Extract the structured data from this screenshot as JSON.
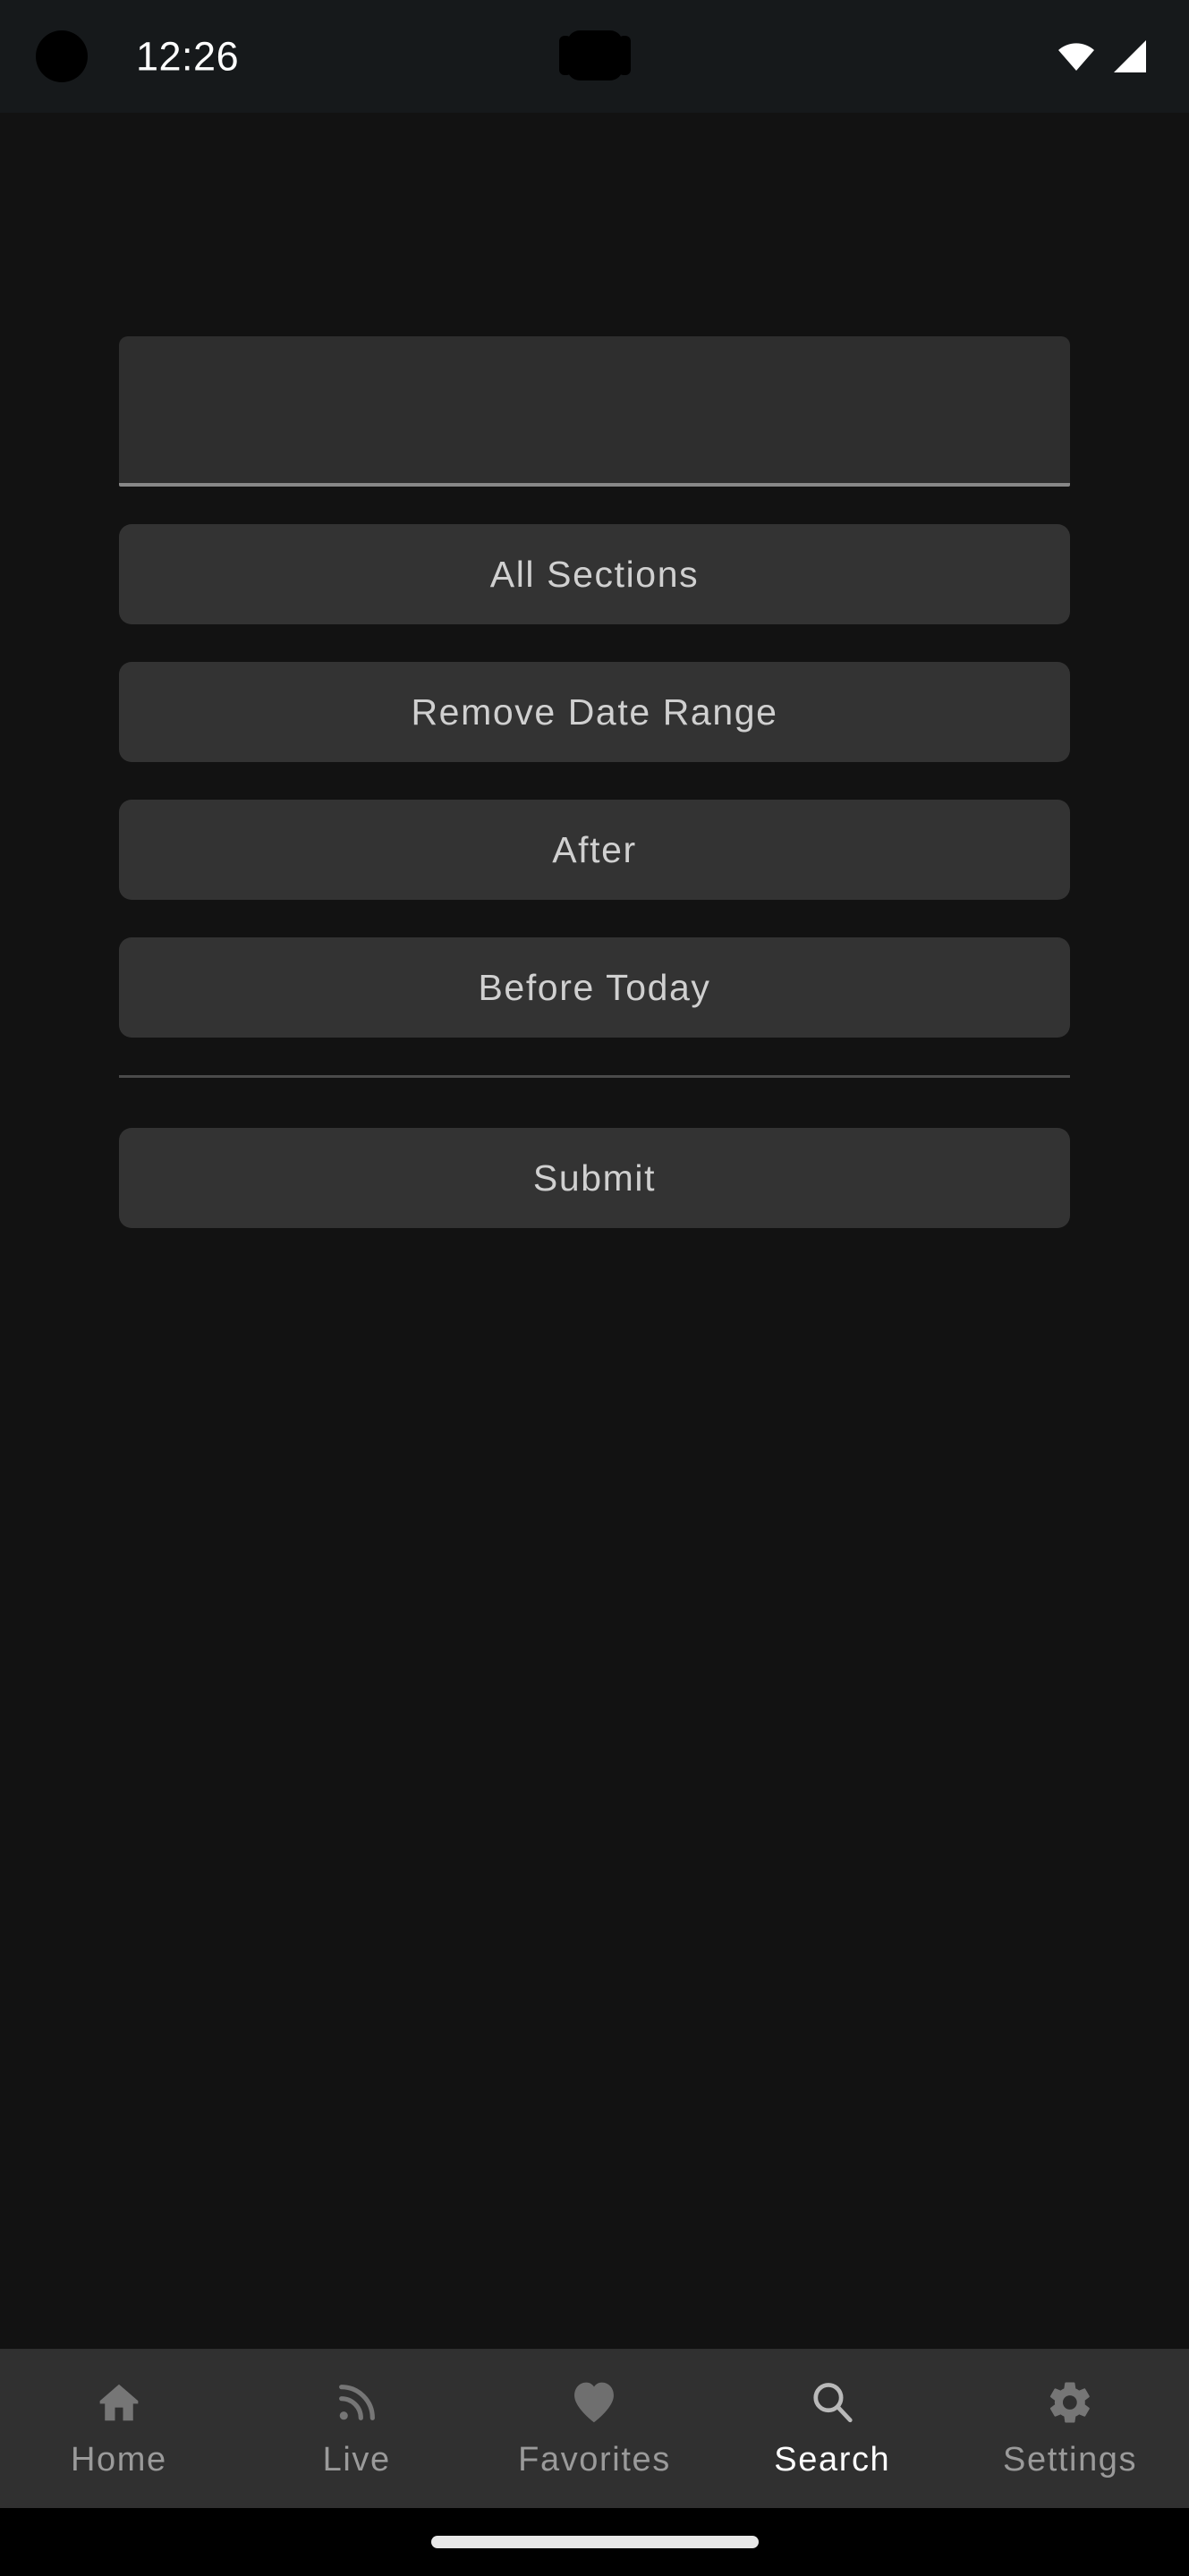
{
  "status_bar": {
    "time": "12:26",
    "icons": [
      {
        "name": "wifi-icon",
        "label": "wifi"
      },
      {
        "name": "cellular-signal-icon",
        "label": "signal"
      }
    ]
  },
  "screen": {
    "background_color": "#121212",
    "surface_color": "#333333",
    "accent_text_color": "#ffffff",
    "muted_text_color": "#9a9a9a"
  },
  "search_form": {
    "query_input": {
      "value": "",
      "placeholder": ""
    },
    "buttons": [
      {
        "id": "all-sections",
        "label": "All Sections"
      },
      {
        "id": "remove-date-range",
        "label": "Remove Date Range"
      },
      {
        "id": "after",
        "label": "After"
      },
      {
        "id": "before-today",
        "label": "Before Today"
      }
    ],
    "submit": {
      "id": "submit",
      "label": "Submit"
    }
  },
  "bottom_nav": {
    "active": "Search",
    "items": [
      {
        "label": "Home",
        "icon": "home-icon",
        "active": false
      },
      {
        "label": "Live",
        "icon": "broadcast-icon",
        "active": false
      },
      {
        "label": "Favorites",
        "icon": "heart-icon",
        "active": false
      },
      {
        "label": "Search",
        "icon": "search-icon",
        "active": true
      },
      {
        "label": "Settings",
        "icon": "gear-icon",
        "active": false
      }
    ]
  }
}
